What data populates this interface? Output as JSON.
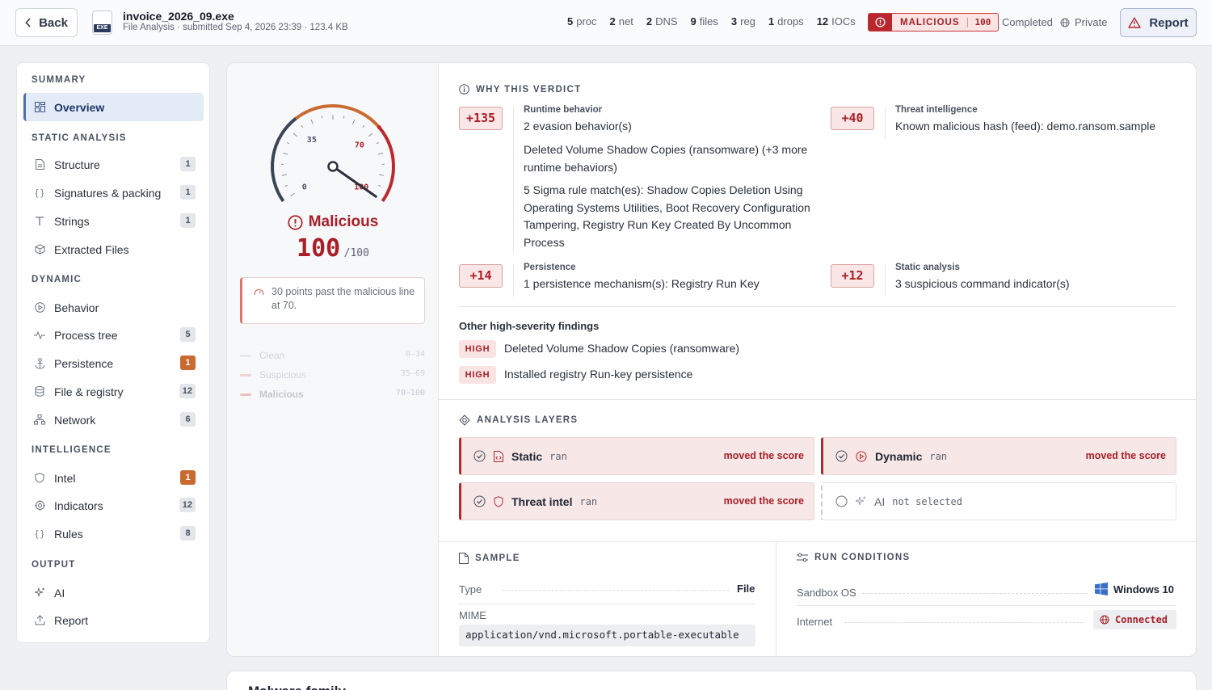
{
  "header": {
    "back_label": "Back",
    "file_badge": "EXE",
    "file_name": "invoice_2026_09.exe",
    "file_subtitle": "File Analysis · submitted Sep 4, 2026 23:39 · 123.4 KB",
    "stats": [
      {
        "count": "5",
        "label": "proc"
      },
      {
        "count": "2",
        "label": "net"
      },
      {
        "count": "2",
        "label": "DNS"
      },
      {
        "count": "9",
        "label": "files"
      },
      {
        "count": "3",
        "label": "reg"
      },
      {
        "count": "1",
        "label": "drops"
      },
      {
        "count": "12",
        "label": "IOCs"
      }
    ],
    "verdict_label": "MALICIOUS",
    "verdict_score": "100",
    "status": "Completed",
    "visibility": "Private",
    "report_label": "Report"
  },
  "sidebar": {
    "sections": {
      "summary": "SUMMARY",
      "static": "STATIC ANALYSIS",
      "dynamic": "DYNAMIC",
      "intel": "INTELLIGENCE",
      "output": "OUTPUT"
    },
    "items": {
      "overview": {
        "label": "Overview"
      },
      "structure": {
        "label": "Structure",
        "count": "1"
      },
      "signatures": {
        "label": "Signatures & packing",
        "count": "1"
      },
      "strings": {
        "label": "Strings",
        "count": "1"
      },
      "extracted": {
        "label": "Extracted Files"
      },
      "behavior": {
        "label": "Behavior"
      },
      "process_tree": {
        "label": "Process tree",
        "count": "5"
      },
      "persistence": {
        "label": "Persistence",
        "count": "1"
      },
      "file_registry": {
        "label": "File & registry",
        "count": "12"
      },
      "network": {
        "label": "Network",
        "count": "6"
      },
      "intel": {
        "label": "Intel",
        "count": "1"
      },
      "indicators": {
        "label": "Indicators",
        "count": "12"
      },
      "rules": {
        "label": "Rules",
        "count": "8"
      },
      "ai": {
        "label": "AI"
      },
      "report": {
        "label": "Report"
      }
    }
  },
  "gauge": {
    "score": 100,
    "max": 100,
    "tick_labels": {
      "t0": "0",
      "t35": "35",
      "t70": "70",
      "t100": "100"
    },
    "verdict": "Malicious",
    "score_text": "100",
    "max_text": "/100",
    "note": "30 points past the malicious line at 70.",
    "bands": [
      {
        "name": "Clean",
        "range": "0–34",
        "color": "#cfd3da"
      },
      {
        "name": "Suspicious",
        "range": "35–69",
        "color": "#e9b9b4"
      },
      {
        "name": "Malicious",
        "range": "70–100",
        "color": "#e9b9b4"
      }
    ]
  },
  "why": {
    "title": "WHY THIS VERDICT",
    "items": [
      {
        "delta": "+135",
        "category": "Runtime behavior",
        "details": [
          "2 evasion behavior(s)",
          "Deleted Volume Shadow Copies (ransomware) (+3 more runtime behaviors)",
          "5 Sigma rule match(es): Shadow Copies Deletion Using Operating Systems Utilities, Boot Recovery Configuration Tampering, Registry Run Key Created By Uncommon Process"
        ]
      },
      {
        "delta": "+40",
        "category": "Threat intelligence",
        "details": [
          "Known malicious hash (feed): demo.ransom.sample"
        ]
      },
      {
        "delta": "+14",
        "category": "Persistence",
        "details": [
          "1 persistence mechanism(s): Registry Run Key"
        ]
      },
      {
        "delta": "+12",
        "category": "Static analysis",
        "details": [
          "3 suspicious command indicator(s)"
        ]
      }
    ],
    "other_title": "Other high-severity findings",
    "findings": [
      {
        "severity": "HIGH",
        "text": "Deleted Volume Shadow Copies (ransomware)"
      },
      {
        "severity": "HIGH",
        "text": "Installed registry Run-key persistence"
      }
    ]
  },
  "layers": {
    "title": "ANALYSIS LAYERS",
    "items": [
      {
        "name": "Static",
        "state": "ran",
        "effect": "moved the score"
      },
      {
        "name": "Dynamic",
        "state": "ran",
        "effect": "moved the score"
      },
      {
        "name": "Threat intel",
        "state": "ran",
        "effect": "moved the score"
      },
      {
        "name": "AI",
        "state": "not selected",
        "effect": ""
      }
    ]
  },
  "sample": {
    "title": "SAMPLE",
    "type_label": "Type",
    "type_value": "File",
    "mime_label": "MIME",
    "mime_value": "application/vnd.microsoft.portable-executable"
  },
  "run": {
    "title": "RUN CONDITIONS",
    "os_label": "Sandbox OS",
    "os_value": "Windows 10",
    "internet_label": "Internet",
    "internet_value": "Connected"
  },
  "next_card_title": "Malware family",
  "colors": {
    "accent": "#a81f27",
    "brand": "#4f6fa6"
  }
}
